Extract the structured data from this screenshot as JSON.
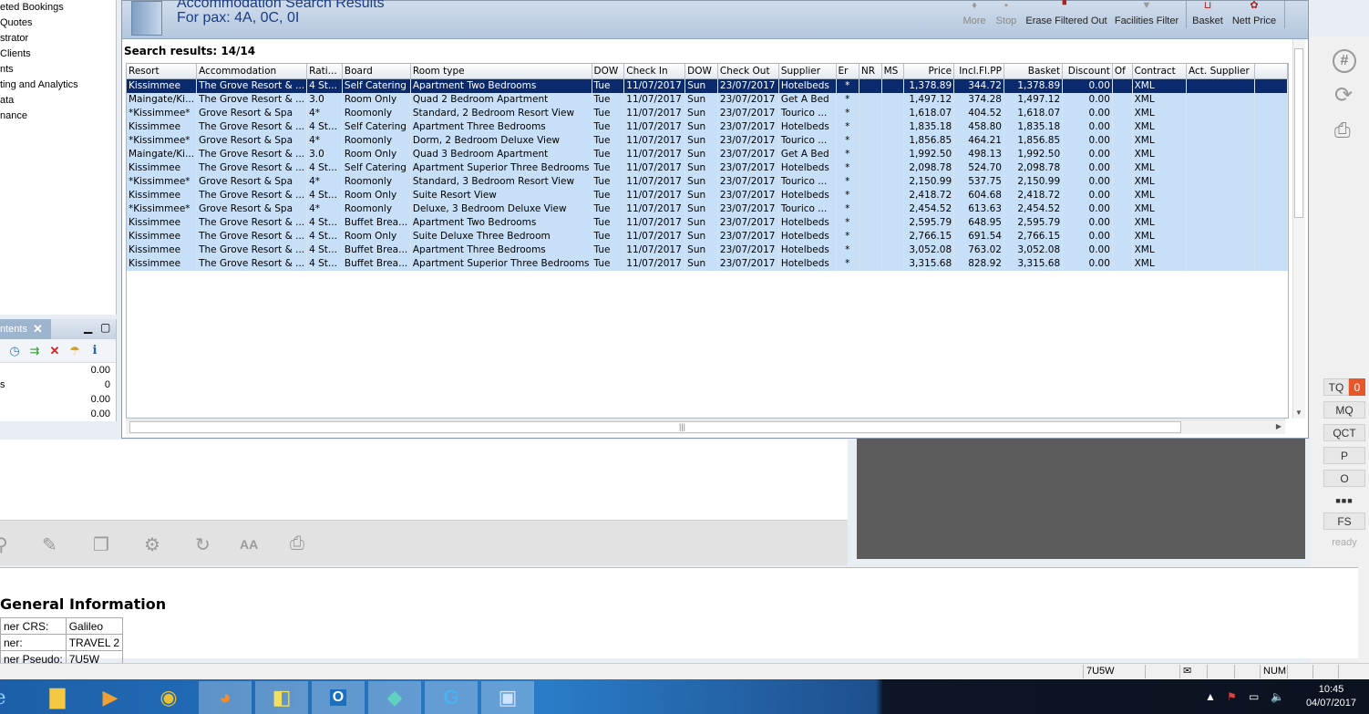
{
  "leftnav": {
    "items": [
      "eted Bookings",
      "Quotes",
      "strator",
      "Clients",
      "nts",
      "ting and Analytics",
      "ata",
      "nance"
    ]
  },
  "contents_panel": {
    "tab_label": "ntents",
    "rows": [
      {
        "label": "",
        "value": "0.00"
      },
      {
        "label": "s",
        "value": "0"
      },
      {
        "label": "",
        "value": "0.00"
      },
      {
        "label": "",
        "value": "0.00"
      }
    ]
  },
  "header": {
    "title": "Accommodation Search Results",
    "pax": "For pax: 4A, 0C, 0I",
    "buttons": {
      "more": "More",
      "stop": "Stop",
      "erase": "Erase Filtered Out",
      "facilities": "Facilities Filter",
      "basket": "Basket",
      "nett_price": "Nett Price"
    }
  },
  "results_label": "Search results: 14/14",
  "columns": [
    "Resort",
    "Accommodation",
    "Rati...",
    "Board",
    "Room type",
    "DOW",
    "Check In",
    "DOW",
    "Check Out",
    "Supplier",
    "Er",
    "NR",
    "MS",
    "Price",
    "Incl.Fl.PP",
    "Basket",
    "Discount",
    "Of",
    "Contract",
    "Act. Supplier"
  ],
  "rows": [
    [
      "Kissimmee",
      "The Grove Resort & ...",
      "4 St...",
      "Self Catering",
      "Apartment Two Bedrooms",
      "Tue",
      "11/07/2017",
      "Sun",
      "23/07/2017",
      "Hotelbeds",
      "*",
      "",
      "",
      "1,378.89",
      "344.72",
      "1,378.89",
      "0.00",
      "",
      "XML",
      ""
    ],
    [
      "Maingate/Ki...",
      "The Grove Resort & ...",
      "3.0",
      "Room Only",
      "Quad 2 Bedroom Apartment",
      "Tue",
      "11/07/2017",
      "Sun",
      "23/07/2017",
      "Get A Bed",
      "*",
      "",
      "",
      "1,497.12",
      "374.28",
      "1,497.12",
      "0.00",
      "",
      "XML",
      ""
    ],
    [
      "*Kissimmee*",
      "Grove Resort & Spa",
      "4*",
      "Roomonly",
      "Standard, 2 Bedroom Resort View",
      "Tue",
      "11/07/2017",
      "Sun",
      "23/07/2017",
      "Tourico ...",
      "*",
      "",
      "",
      "1,618.07",
      "404.52",
      "1,618.07",
      "0.00",
      "",
      "XML",
      ""
    ],
    [
      "Kissimmee",
      "The Grove Resort & ...",
      "4 St...",
      "Self Catering",
      "Apartment Three Bedrooms",
      "Tue",
      "11/07/2017",
      "Sun",
      "23/07/2017",
      "Hotelbeds",
      "*",
      "",
      "",
      "1,835.18",
      "458.80",
      "1,835.18",
      "0.00",
      "",
      "XML",
      ""
    ],
    [
      "*Kissimmee*",
      "Grove Resort & Spa",
      "4*",
      "Roomonly",
      "Dorm, 2 Bedroom Deluxe View",
      "Tue",
      "11/07/2017",
      "Sun",
      "23/07/2017",
      "Tourico ...",
      "*",
      "",
      "",
      "1,856.85",
      "464.21",
      "1,856.85",
      "0.00",
      "",
      "XML",
      ""
    ],
    [
      "Maingate/Ki...",
      "The Grove Resort & ...",
      "3.0",
      "Room Only",
      "Quad 3 Bedroom Apartment",
      "Tue",
      "11/07/2017",
      "Sun",
      "23/07/2017",
      "Get A Bed",
      "*",
      "",
      "",
      "1,992.50",
      "498.13",
      "1,992.50",
      "0.00",
      "",
      "XML",
      ""
    ],
    [
      "Kissimmee",
      "The Grove Resort & ...",
      "4 St...",
      "Self Catering",
      "Apartment Superior Three Bedrooms",
      "Tue",
      "11/07/2017",
      "Sun",
      "23/07/2017",
      "Hotelbeds",
      "*",
      "",
      "",
      "2,098.78",
      "524.70",
      "2,098.78",
      "0.00",
      "",
      "XML",
      ""
    ],
    [
      "*Kissimmee*",
      "Grove Resort & Spa",
      "4*",
      "Roomonly",
      "Standard, 3 Bedroom Resort View",
      "Tue",
      "11/07/2017",
      "Sun",
      "23/07/2017",
      "Tourico ...",
      "*",
      "",
      "",
      "2,150.99",
      "537.75",
      "2,150.99",
      "0.00",
      "",
      "XML",
      ""
    ],
    [
      "Kissimmee",
      "The Grove Resort & ...",
      "4 St...",
      "Room Only",
      "Suite Resort View",
      "Tue",
      "11/07/2017",
      "Sun",
      "23/07/2017",
      "Hotelbeds",
      "*",
      "",
      "",
      "2,418.72",
      "604.68",
      "2,418.72",
      "0.00",
      "",
      "XML",
      ""
    ],
    [
      "*Kissimmee*",
      "Grove Resort & Spa",
      "4*",
      "Roomonly",
      "Deluxe, 3 Bedroom Deluxe View",
      "Tue",
      "11/07/2017",
      "Sun",
      "23/07/2017",
      "Tourico ...",
      "*",
      "",
      "",
      "2,454.52",
      "613.63",
      "2,454.52",
      "0.00",
      "",
      "XML",
      ""
    ],
    [
      "Kissimmee",
      "The Grove Resort & ...",
      "4 St...",
      "Buffet Brea...",
      "Apartment Two Bedrooms",
      "Tue",
      "11/07/2017",
      "Sun",
      "23/07/2017",
      "Hotelbeds",
      "*",
      "",
      "",
      "2,595.79",
      "648.95",
      "2,595.79",
      "0.00",
      "",
      "XML",
      ""
    ],
    [
      "Kissimmee",
      "The Grove Resort & ...",
      "4 St...",
      "Room Only",
      "Suite Deluxe Three Bedroom",
      "Tue",
      "11/07/2017",
      "Sun",
      "23/07/2017",
      "Hotelbeds",
      "*",
      "",
      "",
      "2,766.15",
      "691.54",
      "2,766.15",
      "0.00",
      "",
      "XML",
      ""
    ],
    [
      "Kissimmee",
      "The Grove Resort & ...",
      "4 St...",
      "Buffet Brea...",
      "Apartment Three Bedrooms",
      "Tue",
      "11/07/2017",
      "Sun",
      "23/07/2017",
      "Hotelbeds",
      "*",
      "",
      "",
      "3,052.08",
      "763.02",
      "3,052.08",
      "0.00",
      "",
      "XML",
      ""
    ],
    [
      "Kissimmee",
      "The Grove Resort & ...",
      "4 St...",
      "Buffet Brea...",
      "Apartment Superior Three Bedrooms",
      "Tue",
      "11/07/2017",
      "Sun",
      "23/07/2017",
      "Hotelbeds",
      "*",
      "",
      "",
      "3,315.68",
      "828.92",
      "3,315.68",
      "0.00",
      "",
      "XML",
      ""
    ]
  ],
  "rightbar": {
    "tq": "TQ",
    "tq_count": "0",
    "mq": "MQ",
    "qct": "QCT",
    "p": "P",
    "o": "O",
    "dots": "■■■",
    "fs": "FS",
    "ready": "ready"
  },
  "info": {
    "title": "General Information",
    "rows": [
      {
        "label": "ner CRS:",
        "value": "Galileo"
      },
      {
        "label": "ner:",
        "value": "TRAVEL 2"
      },
      {
        "label": "ner Pseudo:",
        "value": "7U5W"
      }
    ]
  },
  "statusbar": {
    "pcc": "7U5W",
    "num": "NUM"
  },
  "taskbar": {
    "time": "10:45",
    "date": "04/07/2017"
  },
  "colors": {
    "selected_row": "#0b2a6e",
    "row_bg": "#c8e0f7",
    "header_title": "#1a3c86",
    "tq_badge": "#e8572a"
  }
}
